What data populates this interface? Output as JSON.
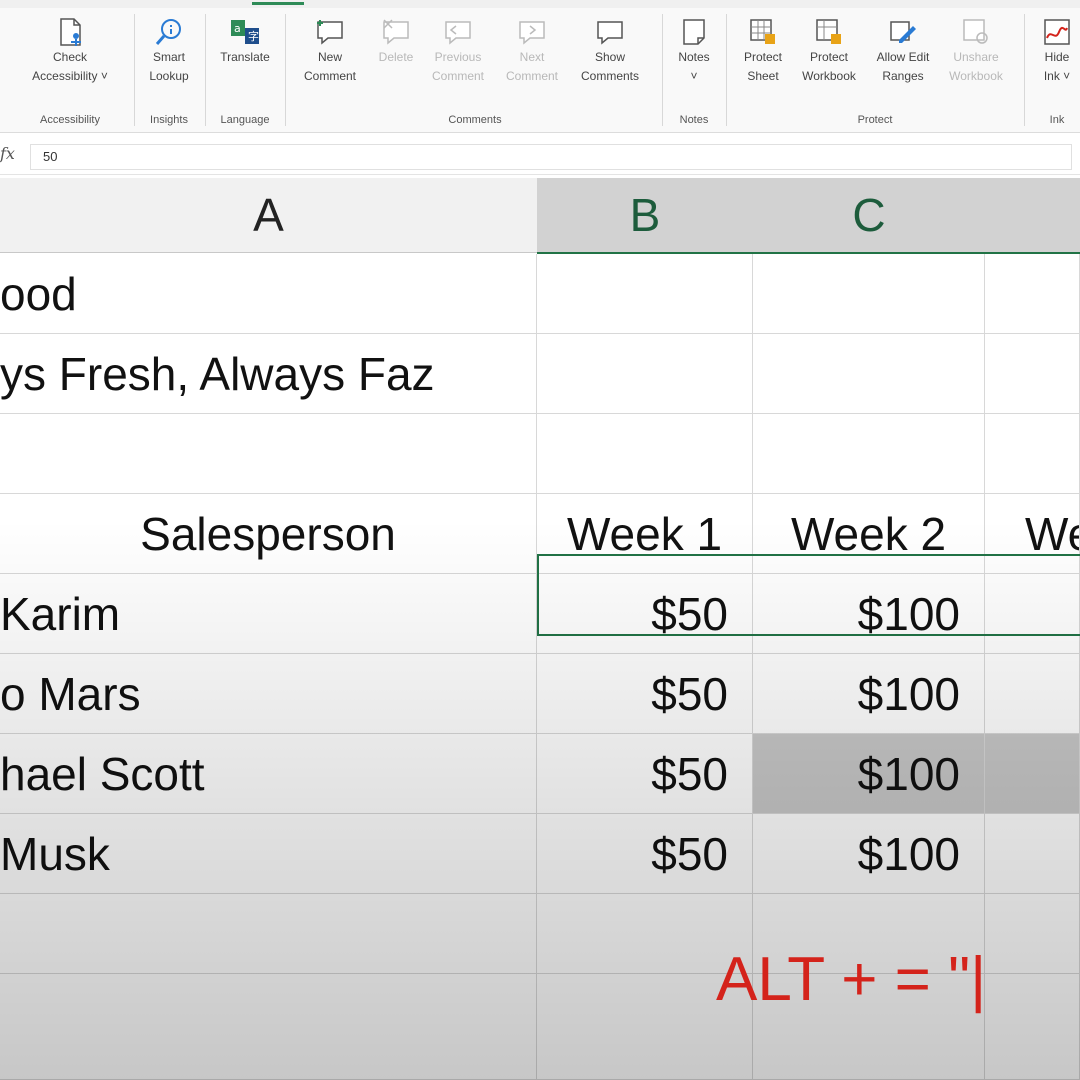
{
  "ribbon": {
    "groups": {
      "accessibility": {
        "label": "Accessibility",
        "check_accessibility": "Check\nAccessibility ˅"
      },
      "insights": {
        "label": "Insights",
        "smart_lookup": "Smart\nLookup"
      },
      "language": {
        "label": "Language",
        "translate": "Translate"
      },
      "comments": {
        "label": "Comments",
        "new_comment": "New\nComment",
        "delete": "Delete",
        "previous_comment": "Previous\nComment",
        "next_comment": "Next\nComment",
        "show_comments": "Show\nComments"
      },
      "notes": {
        "label": "Notes",
        "notes": "Notes\n˅"
      },
      "protect": {
        "label": "Protect",
        "protect_sheet": "Protect\nSheet",
        "protect_workbook": "Protect\nWorkbook",
        "allow_edit_ranges": "Allow Edit\nRanges",
        "unshare_workbook": "Unshare\nWorkbook"
      },
      "ink": {
        "label": "Ink",
        "hide_ink": "Hide\nInk ˅"
      }
    }
  },
  "formula_bar": {
    "fx": "fx",
    "value": "50"
  },
  "columns": [
    "A",
    "B",
    "C"
  ],
  "rows": [
    {
      "a": "ood",
      "b": "",
      "c": ""
    },
    {
      "a": "ys Fresh, Always Faz",
      "b": "",
      "c": ""
    },
    {
      "a": "",
      "b": "",
      "c": ""
    },
    {
      "a": "Salesperson",
      "b": "Week 1",
      "c": "Week 2",
      "d": "We"
    },
    {
      "a": "Karim",
      "b": "$50",
      "c": "$100"
    },
    {
      "a": "o Mars",
      "b": "$50",
      "c": "$100"
    },
    {
      "a": "hael Scott",
      "b": "$50",
      "c": "$100"
    },
    {
      "a": "Musk",
      "b": "$50",
      "c": "$100"
    }
  ],
  "overlay": {
    "shortcut_text": "ALT + = \"|"
  },
  "colors": {
    "accent": "#217346",
    "shortcut": "#d4231b"
  }
}
